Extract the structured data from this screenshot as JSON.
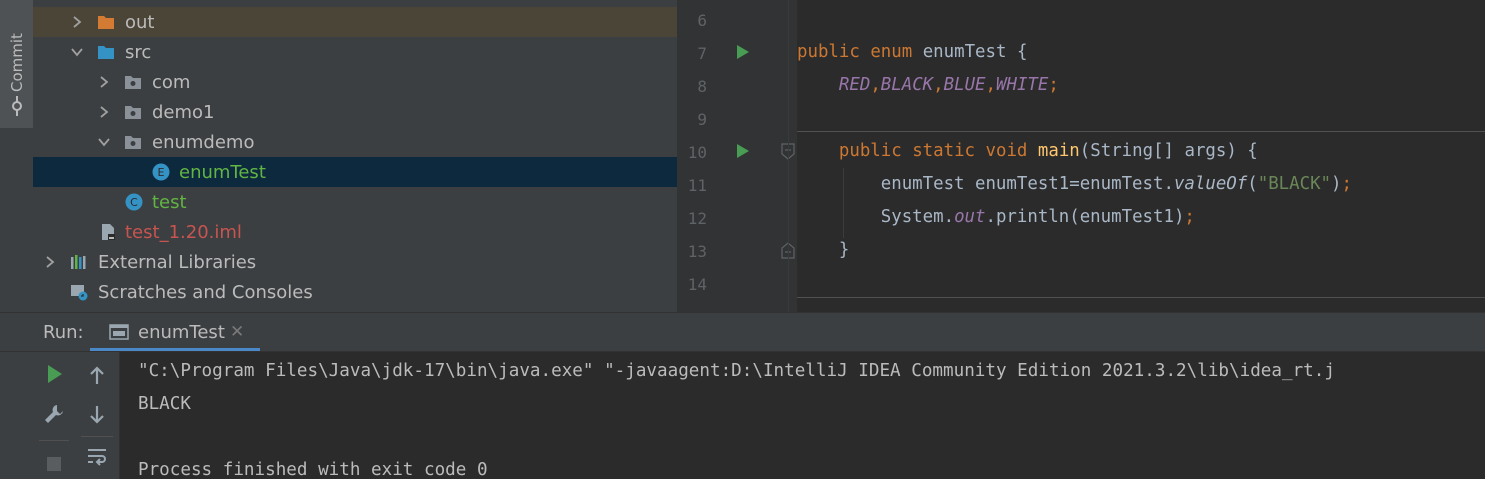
{
  "sidebar": {
    "commit_label": "Commit"
  },
  "project_tree": {
    "items": [
      {
        "label": "out",
        "color": "#bbbbbb"
      },
      {
        "label": "src",
        "color": "#bbbbbb"
      },
      {
        "label": "com",
        "color": "#bbbbbb"
      },
      {
        "label": "demo1",
        "color": "#bbbbbb"
      },
      {
        "label": "enumdemo",
        "color": "#bbbbbb"
      },
      {
        "label": "enumTest",
        "color": "#62b543",
        "badge": "E"
      },
      {
        "label": "test",
        "color": "#62b543",
        "badge": "C"
      },
      {
        "label": "test_1.20.iml",
        "color": "#c75450"
      },
      {
        "label": "External Libraries",
        "color": "#bbbbbb"
      },
      {
        "label": "Scratches and Consoles",
        "color": "#bbbbbb"
      }
    ]
  },
  "editor": {
    "line_numbers": [
      "6",
      "7",
      "8",
      "9",
      "10",
      "11",
      "12",
      "13",
      "14"
    ],
    "lines": {
      "l7": {
        "kw1": "public",
        "kw2": "enum",
        "name": "enumTest",
        "brace": "{"
      },
      "l8": {
        "c1": "RED",
        "c2": "BLACK",
        "c3": "BLUE",
        "c4": "WHITE",
        "comma": ",",
        "semi": ";"
      },
      "l10": {
        "kw1": "public",
        "kw2": "static",
        "kw3": "void",
        "fn": "main",
        "params": "(String[] args) {"
      },
      "l11": {
        "pre": "enumTest enumTest1=enumTest.",
        "method": "valueOf",
        "open": "(",
        "str": "\"BLACK\"",
        "close": ")",
        "semi": ";"
      },
      "l12": {
        "pre": "System.",
        "field": "out",
        "post": ".println(enumTest1)",
        "semi": ";"
      },
      "l13": {
        "brace": "}"
      }
    }
  },
  "run_panel": {
    "title": "Run:",
    "tab_label": "enumTest",
    "tab_close": "✕",
    "console": [
      "\"C:\\Program Files\\Java\\jdk-17\\bin\\java.exe\" \"-javaagent:D:\\IntelliJ IDEA Community Edition 2021.3.2\\lib\\idea_rt.j",
      "BLACK",
      "",
      "Process finished with exit code 0"
    ]
  },
  "colors": {
    "accent_run": "#499c54",
    "keyword": "#cc7832",
    "constant": "#9876aa",
    "function": "#ffc66d",
    "string": "#6a8759"
  }
}
